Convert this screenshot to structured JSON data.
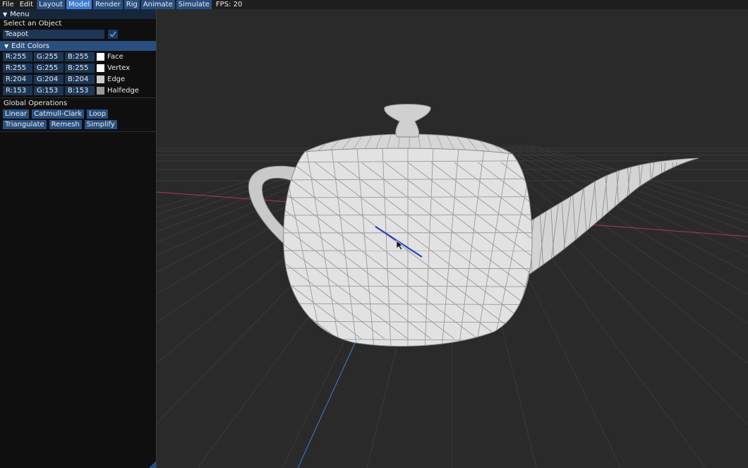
{
  "menubar": {
    "items": [
      {
        "label": "File",
        "style": "plain"
      },
      {
        "label": "Edit",
        "style": "plain"
      },
      {
        "label": "Layout",
        "style": "mode"
      },
      {
        "label": "Model",
        "style": "active"
      },
      {
        "label": "Render",
        "style": "mode"
      },
      {
        "label": "Rig",
        "style": "mode"
      },
      {
        "label": "Animate",
        "style": "mode"
      },
      {
        "label": "Simulate",
        "style": "mode"
      }
    ],
    "fps": "FPS: 20"
  },
  "panel": {
    "title": "Menu",
    "select_label": "Select an Object",
    "selected_object": "Teapot",
    "edit_colors_label": "Edit Colors",
    "colors": [
      {
        "r": "R:255",
        "g": "G:255",
        "b": "B:255",
        "label": "Face",
        "swatch": "#ffffff"
      },
      {
        "r": "R:255",
        "g": "G:255",
        "b": "B:255",
        "label": "Vertex",
        "swatch": "#ffffff"
      },
      {
        "r": "R:204",
        "g": "G:204",
        "b": "B:204",
        "label": "Edge",
        "swatch": "#cccccc"
      },
      {
        "r": "R:153",
        "g": "G:153",
        "b": "B:153",
        "label": "Halfedge",
        "swatch": "#999999"
      }
    ],
    "global_ops_label": "Global Operations",
    "ops_row1": [
      "Linear",
      "Catmull-Clark",
      "Loop"
    ],
    "ops_row2": [
      "Triangulate",
      "Remesh",
      "Simplify"
    ]
  },
  "viewport": {
    "background": "#2a2a2a",
    "x_axis_color": "#b03a4a",
    "z_axis_color": "#3b7fd0",
    "selected_edge_color": "#2b3fb0"
  }
}
